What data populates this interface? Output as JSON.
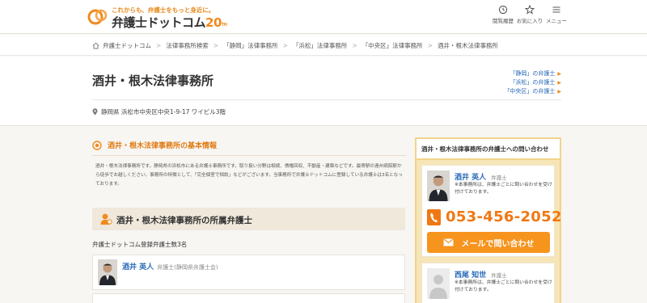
{
  "header": {
    "tagline": "これからも、弁護士をもっと身近に。",
    "site_name": "弁護士ドットコム",
    "anniversary": "20",
    "anniversary_suffix": "TH",
    "nav": [
      {
        "label": "閲覧履歴",
        "icon": "history-icon"
      },
      {
        "label": "お気に入り",
        "icon": "star-icon"
      },
      {
        "label": "メニュー",
        "icon": "menu-icon"
      }
    ]
  },
  "breadcrumb": [
    "弁護士ドットコム",
    "法律事務所検索",
    "「静岡」法律事務所",
    "「浜松」法律事務所",
    "「中央区」法律事務所",
    "酒井・根木法律事務所"
  ],
  "office": {
    "name": "酒井・根木法律事務所",
    "address": "静岡県 浜松市中央区中央1-9-17 ワイビル3階",
    "area_links": [
      "「静岡」の弁護士",
      "「浜松」の弁護士",
      "「中央区」の弁護士"
    ]
  },
  "basic_info": {
    "title": "酒井・根木法律事務所の基本情報",
    "text": "酒井・根木法律事務所です。静岡県の浜松市にある弁護士事務所です。取り扱い分野は相続、債権回収、不動産・建築などです。最寄駅の遠州病院駅から徒歩でお越しください。事務所の特徴として、「完全個室で相談」などがございます。当事務所で弁護士ドットコムに登録している弁護士は3名となっております。"
  },
  "lawyers_section": {
    "title": "酒井・根木法律事務所の所属弁護士",
    "count_text": "弁護士ドットコム登録弁護士数3名",
    "rows": [
      {
        "name": "酒井 英人",
        "association": "弁護士(静岡県弁護士会)"
      }
    ]
  },
  "sidebar": {
    "title": "酒井・根木法律事務所の弁護士への問い合わせ",
    "cards": [
      {
        "name": "酒井 英人",
        "role": "弁護士",
        "note": "※本事務所は、弁護士ごとに問い合わせを受け付けております。",
        "phone": "053-456-2052",
        "mail_label": "メールで問い合わせ"
      },
      {
        "name": "西尾 知世",
        "role": "弁護士",
        "note": "※本事務所は、弁護士ごとに問い合わせを受け付けております。"
      }
    ]
  },
  "colors": {
    "accent": "#f08a1c",
    "link": "#2869b8",
    "sidebar_bg": "#f6e5b6",
    "section_bg": "#efe8db"
  }
}
